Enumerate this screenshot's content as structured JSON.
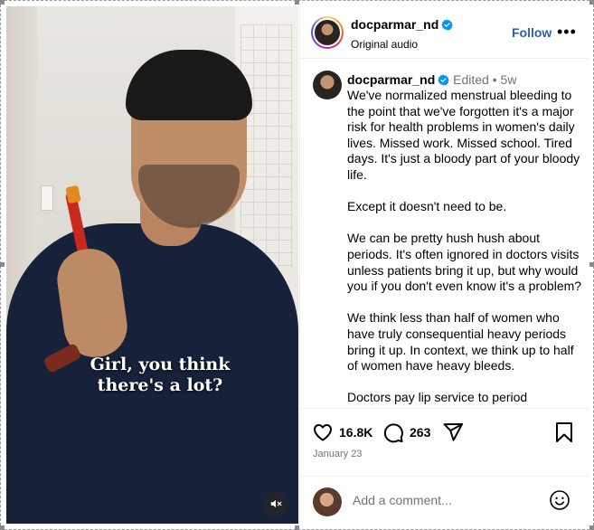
{
  "video": {
    "caption_line1": "Girl, you think",
    "caption_line2": "there's a lot?"
  },
  "header": {
    "username": "docparmar_nd",
    "subtitle": "Original audio",
    "follow_label": "Follow",
    "more_label": "•••"
  },
  "comment": {
    "username": "docparmar_nd",
    "edited_label": "Edited",
    "separator": "•",
    "age": "5w",
    "paragraphs": [
      "We've normalized menstrual bleeding to the point that we've forgotten it's a major risk for health problems in women's daily lives. Missed work. Missed school. Tired days. It's just a bloody part of your bloody life.",
      "Except it doesn't need to be.",
      "We can be pretty hush hush about periods. It's often ignored in doctors visits unless patients bring it up, but why would you if you don't even know it's a problem?",
      "We think less than half of women who have truly consequential heavy periods bring it up. In context, we think up to half of women have heavy bleeds.",
      "Doctors pay lip service to period"
    ]
  },
  "actions": {
    "likes": "16.8K",
    "comments": "263",
    "date": "January 23"
  },
  "composer": {
    "placeholder": "Add a comment..."
  },
  "colors": {
    "follow": "#2b62a8",
    "verified": "#0095f6",
    "muted_text": "#737373"
  },
  "icons": [
    "verified-badge-icon",
    "heart-icon",
    "comment-icon",
    "share-icon",
    "bookmark-icon",
    "mute-icon",
    "emoji-icon",
    "more-icon"
  ]
}
